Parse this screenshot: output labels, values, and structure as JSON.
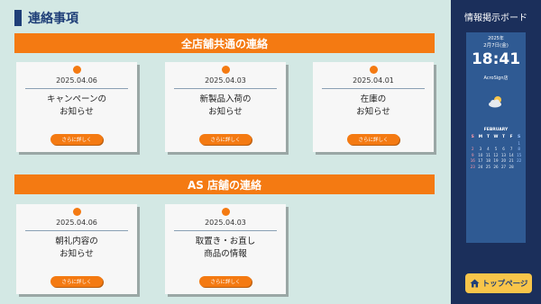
{
  "page_title": "連絡事項",
  "sections": [
    {
      "header": "全店舗共通の連絡",
      "cards": [
        {
          "date": "2025.04.06",
          "title_line1": "キャンペーンの",
          "title_line2": "お知らせ",
          "button": "さらに詳しく"
        },
        {
          "date": "2025.04.03",
          "title_line1": "新製品入荷の",
          "title_line2": "お知らせ",
          "button": "さらに詳しく"
        },
        {
          "date": "2025.04.01",
          "title_line1": "在庫の",
          "title_line2": "お知らせ",
          "button": "さらに詳しく"
        }
      ]
    },
    {
      "header": "AS 店舗の連絡",
      "cards": [
        {
          "date": "2025.04.06",
          "title_line1": "朝礼内容の",
          "title_line2": "お知らせ",
          "button": "さらに詳しく"
        },
        {
          "date": "2025.04.03",
          "title_line1": "取置き・お直し",
          "title_line2": "商品の情報",
          "button": "さらに詳しく"
        }
      ]
    }
  ],
  "sidebar": {
    "title": "情報掲示ボード",
    "widget": {
      "year": "2025年",
      "date": "2月7日(金)",
      "time": "18:41",
      "store": "AcroSign店",
      "weather_icon": "partly-cloudy-icon",
      "calendar": {
        "month": "FEBRUARY",
        "weekdays": [
          "S",
          "M",
          "T",
          "W",
          "T",
          "F",
          "S"
        ],
        "weeks": [
          [
            "",
            "",
            "",
            "",
            "",
            "",
            "1"
          ],
          [
            "2",
            "3",
            "4",
            "5",
            "6",
            "7",
            "8"
          ],
          [
            "9",
            "10",
            "11",
            "12",
            "13",
            "14",
            "15"
          ],
          [
            "16",
            "17",
            "18",
            "19",
            "20",
            "21",
            "22"
          ],
          [
            "23",
            "24",
            "25",
            "26",
            "27",
            "28",
            ""
          ]
        ]
      }
    },
    "top_button": "トップページ"
  },
  "colors": {
    "accent_orange": "#f47a12",
    "navy": "#1b2f5b",
    "widget_blue": "#2f5a93",
    "background": "#d3e8e4",
    "top_button_yellow": "#f8c54a"
  }
}
